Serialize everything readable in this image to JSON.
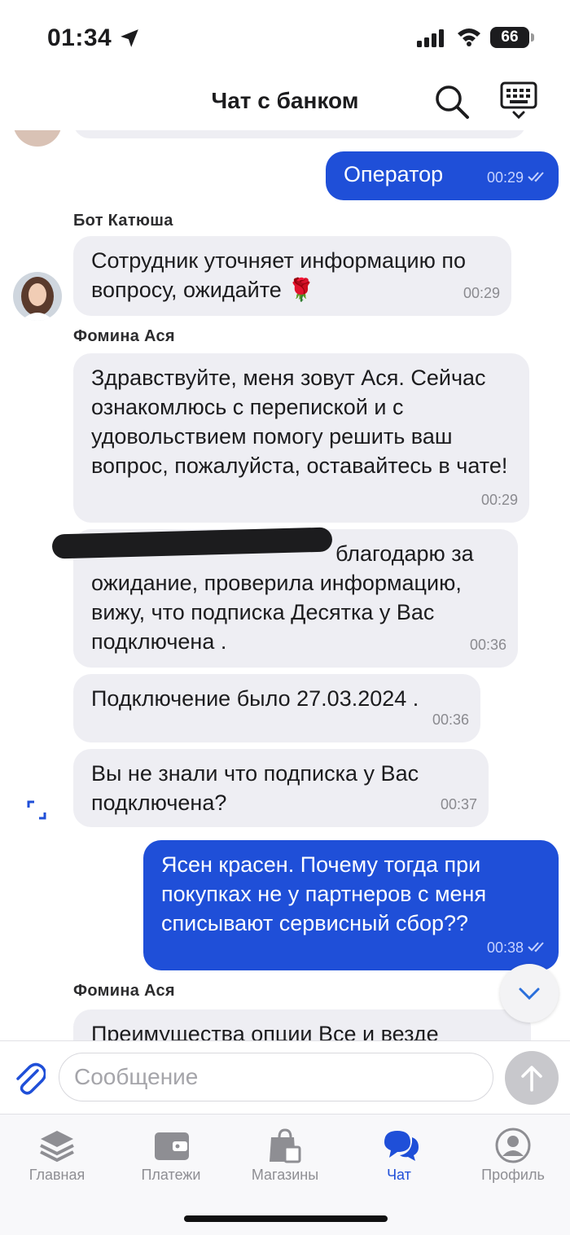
{
  "status_bar": {
    "time": "01:34",
    "battery": "66"
  },
  "header": {
    "title": "Чат с банком"
  },
  "messages": [
    {
      "dir": "out",
      "text": "Оператор",
      "time": "00:29"
    },
    {
      "dir": "in",
      "sender": "Бот Катюша",
      "text": "Сотрудник уточняет информацию по вопросу, ожидайте 🌹",
      "time": "00:29"
    },
    {
      "dir": "in",
      "sender": "Фомина Ася",
      "text": "Здравствуйте, меня зовут  Ася. Сейчас ознакомлюсь с перепиской и с удовольствием помогу решить ваш вопрос, пожалуйста, оставайтесь в чате!",
      "time": "00:29"
    },
    {
      "dir": "in",
      "text": "благодарю за ожидание, проверила информацию, вижу, что подписка Десятка у Вас подключена .",
      "time": "00:36"
    },
    {
      "dir": "in",
      "text": "Подключение было 27.03.2024 .",
      "time": "00:36"
    },
    {
      "dir": "in",
      "text": "Вы не знали что подписка у Вас подключена?",
      "time": "00:37"
    },
    {
      "dir": "out",
      "text": "Ясен красен. Почему тогда при покупках не у партнеров с меня списывают сервисный сбор??",
      "time": "00:38"
    },
    {
      "dir": "in",
      "sender": "Фомина Ася",
      "text": "Преимущества опции Все и везде"
    }
  ],
  "input": {
    "placeholder": "Сообщение"
  },
  "tabs": [
    {
      "label": "Главная",
      "icon": "layers-icon"
    },
    {
      "label": "Платежи",
      "icon": "wallet-icon"
    },
    {
      "label": "Магазины",
      "icon": "shopping-bag-icon"
    },
    {
      "label": "Чат",
      "icon": "chat-bubbles-icon",
      "active": true
    },
    {
      "label": "Профиль",
      "icon": "profile-icon"
    }
  ],
  "colors": {
    "accent": "#1f4fd8",
    "incoming_bubble": "#eeeef3",
    "muted": "#8e8e93"
  }
}
